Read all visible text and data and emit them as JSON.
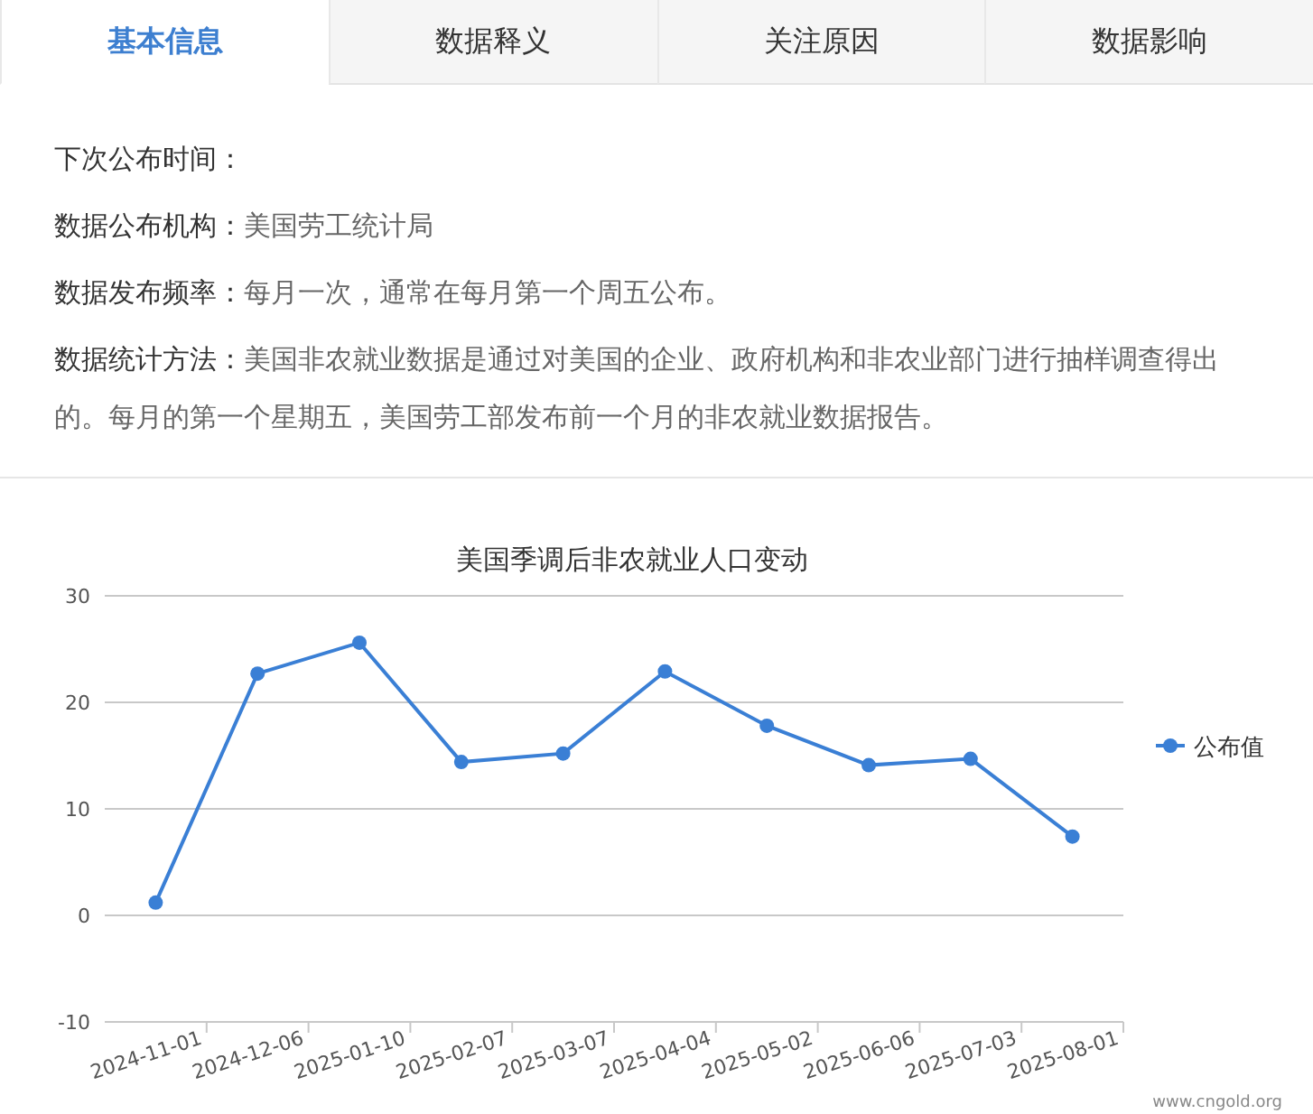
{
  "tabs": [
    {
      "label": "基本信息",
      "selected": true
    },
    {
      "label": "数据释义",
      "selected": false
    },
    {
      "label": "关注原因",
      "selected": false
    },
    {
      "label": "数据影响",
      "selected": false
    }
  ],
  "info": [
    {
      "label": "下次公布时间："
    },
    {
      "label": "数据公布机构：",
      "value": "美国劳工统计局"
    },
    {
      "label": "数据发布频率：",
      "value": "每月一次，通常在每月第一个周五公布。"
    },
    {
      "label": "数据统计方法：",
      "value": "美国非农就业数据是通过对美国的企业、政府机构和非农业部门进行抽样调查得出的。每月的第一个星期五，美国劳工部发布前一个月的非农就业数据报告。"
    }
  ],
  "chart": {
    "chart_data": {
      "type": "line",
      "title": "美国季调后非农就业人口变动",
      "categories": [
        "2024-11-01",
        "2024-12-06",
        "2025-01-10",
        "2025-02-07",
        "2025-03-07",
        "2025-04-04",
        "2025-05-02",
        "2025-06-06",
        "2025-07-03",
        "2025-08-01"
      ],
      "series": [
        {
          "name": "公布值",
          "color": "#3a7fd5",
          "marker": true,
          "values": [
            1.2,
            22.7,
            25.6,
            14.4,
            15.2,
            22.9,
            17.8,
            14.1,
            14.7,
            7.4
          ]
        }
      ],
      "ylim": [
        -10,
        30
      ],
      "yticks": [
        -10,
        0,
        10,
        20,
        30
      ],
      "grid": true
    },
    "credit": "www.cngold.org"
  }
}
